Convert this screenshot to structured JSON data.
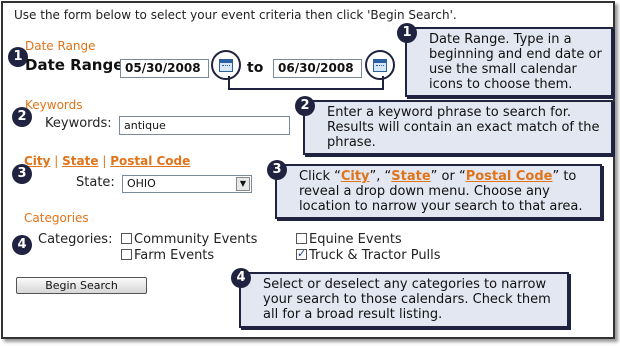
{
  "intro": "Use the form below to select your event criteria then click 'Begin Search'.",
  "sections": {
    "date": {
      "num": "1",
      "heading": "Date Range",
      "label": "Date Range:",
      "start": "05/30/2008",
      "to": "to",
      "end": "06/30/2008"
    },
    "keywords": {
      "num": "2",
      "heading": "Keywords",
      "label": "Keywords:",
      "value": "antique"
    },
    "location": {
      "num": "3",
      "city": "City",
      "sep1": " | ",
      "state": "State",
      "sep2": " | ",
      "postal": "Postal Code",
      "label": "State:",
      "selected": "OHIO"
    },
    "categories": {
      "num": "4",
      "heading": "Categories",
      "label": "Categories:",
      "items": [
        {
          "label": "Community Events",
          "checked": false
        },
        {
          "label": "Equine Events",
          "checked": false
        },
        {
          "label": "Farm Events",
          "checked": false
        },
        {
          "label": "Truck & Tractor Pulls",
          "checked": true
        }
      ]
    }
  },
  "button": {
    "label": "Begin Search"
  },
  "callouts": {
    "c1": {
      "num": "1",
      "text": "Date Range. Type in a beginning and end date or use the small calendar icons to choose them."
    },
    "c2": {
      "num": "2",
      "text": "Enter a keyword phrase to search for. Results will contain an exact match of the phrase."
    },
    "c3": {
      "num": "3",
      "pre": "Click “",
      "city": "City",
      "mid1": "”, “",
      "state": "State",
      "mid2": "” or “",
      "postal": "Postal Code",
      "post": "” to reveal a drop down menu. Choose any location to narrow your search to that area."
    },
    "c4": {
      "num": "4",
      "text": "Select or deselect any categories to narrow your search to those calendars. Check them all for a broad result listing."
    }
  },
  "colors": {
    "accent": "#e0741a",
    "navy": "#1f2340",
    "callout_bg": "#e3e7f2"
  }
}
